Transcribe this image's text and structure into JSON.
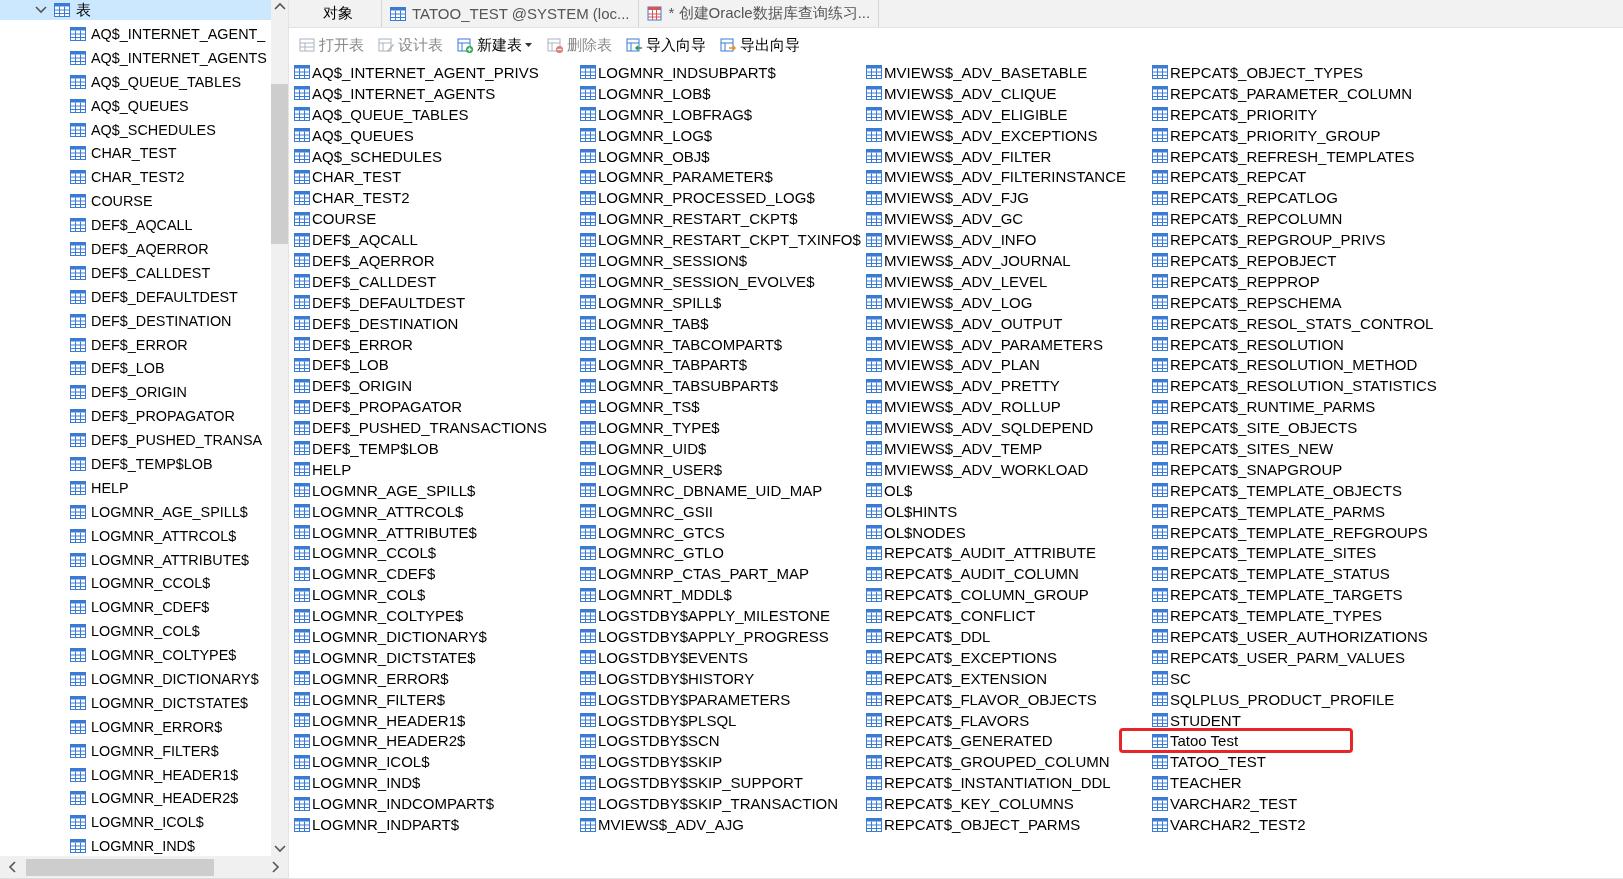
{
  "tree": {
    "label": "表",
    "expanded": true,
    "selected": true,
    "children": [
      "AQ$_INTERNET_AGENT_",
      "AQ$_INTERNET_AGENTS",
      "AQ$_QUEUE_TABLES",
      "AQ$_QUEUES",
      "AQ$_SCHEDULES",
      "CHAR_TEST",
      "CHAR_TEST2",
      "COURSE",
      "DEF$_AQCALL",
      "DEF$_AQERROR",
      "DEF$_CALLDEST",
      "DEF$_DEFAULTDEST",
      "DEF$_DESTINATION",
      "DEF$_ERROR",
      "DEF$_LOB",
      "DEF$_ORIGIN",
      "DEF$_PROPAGATOR",
      "DEF$_PUSHED_TRANSA",
      "DEF$_TEMP$LOB",
      "HELP",
      "LOGMNR_AGE_SPILL$",
      "LOGMNR_ATTRCOL$",
      "LOGMNR_ATTRIBUTE$",
      "LOGMNR_CCOL$",
      "LOGMNR_CDEF$",
      "LOGMNR_COL$",
      "LOGMNR_COLTYPE$",
      "LOGMNR_DICTIONARY$",
      "LOGMNR_DICTSTATE$",
      "LOGMNR_ERROR$",
      "LOGMNR_FILTER$",
      "LOGMNR_HEADER1$",
      "LOGMNR_HEADER2$",
      "LOGMNR_ICOL$",
      "LOGMNR_IND$"
    ]
  },
  "tabs": [
    {
      "label": "对象",
      "selected": true,
      "kind": "plain"
    },
    {
      "label": "TATOO_TEST @SYSTEM (loc...",
      "selected": false,
      "kind": "table"
    },
    {
      "label": "* 创建Oracle数据库查询练习...",
      "selected": false,
      "kind": "query"
    }
  ],
  "toolbar": [
    {
      "label": "打开表",
      "disabled": true,
      "kind": "open"
    },
    {
      "label": "设计表",
      "disabled": true,
      "kind": "design"
    },
    {
      "label": "新建表",
      "disabled": false,
      "kind": "new"
    },
    {
      "label": "删除表",
      "disabled": true,
      "kind": "delete"
    },
    {
      "label": "导入向导",
      "disabled": false,
      "kind": "import"
    },
    {
      "label": "导出向导",
      "disabled": false,
      "kind": "export"
    }
  ],
  "objects": [
    {
      "name": "AQ$_INTERNET_AGENT_PRIVS",
      "highlighted": false
    },
    {
      "name": "AQ$_INTERNET_AGENTS",
      "highlighted": false
    },
    {
      "name": "AQ$_QUEUE_TABLES",
      "highlighted": false
    },
    {
      "name": "AQ$_QUEUES",
      "highlighted": false
    },
    {
      "name": "AQ$_SCHEDULES",
      "highlighted": false
    },
    {
      "name": "CHAR_TEST",
      "highlighted": false
    },
    {
      "name": "CHAR_TEST2",
      "highlighted": false
    },
    {
      "name": "COURSE",
      "highlighted": false
    },
    {
      "name": "DEF$_AQCALL",
      "highlighted": false
    },
    {
      "name": "DEF$_AQERROR",
      "highlighted": false
    },
    {
      "name": "DEF$_CALLDEST",
      "highlighted": false
    },
    {
      "name": "DEF$_DEFAULTDEST",
      "highlighted": false
    },
    {
      "name": "DEF$_DESTINATION",
      "highlighted": false
    },
    {
      "name": "DEF$_ERROR",
      "highlighted": false
    },
    {
      "name": "DEF$_LOB",
      "highlighted": false
    },
    {
      "name": "DEF$_ORIGIN",
      "highlighted": false
    },
    {
      "name": "DEF$_PROPAGATOR",
      "highlighted": false
    },
    {
      "name": "DEF$_PUSHED_TRANSACTIONS",
      "highlighted": false
    },
    {
      "name": "DEF$_TEMP$LOB",
      "highlighted": false
    },
    {
      "name": "HELP",
      "highlighted": false
    },
    {
      "name": "LOGMNR_AGE_SPILL$",
      "highlighted": false
    },
    {
      "name": "LOGMNR_ATTRCOL$",
      "highlighted": false
    },
    {
      "name": "LOGMNR_ATTRIBUTE$",
      "highlighted": false
    },
    {
      "name": "LOGMNR_CCOL$",
      "highlighted": false
    },
    {
      "name": "LOGMNR_CDEF$",
      "highlighted": false
    },
    {
      "name": "LOGMNR_COL$",
      "highlighted": false
    },
    {
      "name": "LOGMNR_COLTYPE$",
      "highlighted": false
    },
    {
      "name": "LOGMNR_DICTIONARY$",
      "highlighted": false
    },
    {
      "name": "LOGMNR_DICTSTATE$",
      "highlighted": false
    },
    {
      "name": "LOGMNR_ERROR$",
      "highlighted": false
    },
    {
      "name": "LOGMNR_FILTER$",
      "highlighted": false
    },
    {
      "name": "LOGMNR_HEADER1$",
      "highlighted": false
    },
    {
      "name": "LOGMNR_HEADER2$",
      "highlighted": false
    },
    {
      "name": "LOGMNR_ICOL$",
      "highlighted": false
    },
    {
      "name": "LOGMNR_IND$",
      "highlighted": false
    },
    {
      "name": "LOGMNR_INDCOMPART$",
      "highlighted": false
    },
    {
      "name": "LOGMNR_INDPART$",
      "highlighted": false
    },
    {
      "name": "LOGMNR_INDSUBPART$",
      "highlighted": false
    },
    {
      "name": "LOGMNR_LOB$",
      "highlighted": false
    },
    {
      "name": "LOGMNR_LOBFRAG$",
      "highlighted": false
    },
    {
      "name": "LOGMNR_LOG$",
      "highlighted": false
    },
    {
      "name": "LOGMNR_OBJ$",
      "highlighted": false
    },
    {
      "name": "LOGMNR_PARAMETER$",
      "highlighted": false
    },
    {
      "name": "LOGMNR_PROCESSED_LOG$",
      "highlighted": false
    },
    {
      "name": "LOGMNR_RESTART_CKPT$",
      "highlighted": false
    },
    {
      "name": "LOGMNR_RESTART_CKPT_TXINFO$",
      "highlighted": false
    },
    {
      "name": "LOGMNR_SESSION$",
      "highlighted": false
    },
    {
      "name": "LOGMNR_SESSION_EVOLVE$",
      "highlighted": false
    },
    {
      "name": "LOGMNR_SPILL$",
      "highlighted": false
    },
    {
      "name": "LOGMNR_TAB$",
      "highlighted": false
    },
    {
      "name": "LOGMNR_TABCOMPART$",
      "highlighted": false
    },
    {
      "name": "LOGMNR_TABPART$",
      "highlighted": false
    },
    {
      "name": "LOGMNR_TABSUBPART$",
      "highlighted": false
    },
    {
      "name": "LOGMNR_TS$",
      "highlighted": false
    },
    {
      "name": "LOGMNR_TYPE$",
      "highlighted": false
    },
    {
      "name": "LOGMNR_UID$",
      "highlighted": false
    },
    {
      "name": "LOGMNR_USER$",
      "highlighted": false
    },
    {
      "name": "LOGMNRC_DBNAME_UID_MAP",
      "highlighted": false
    },
    {
      "name": "LOGMNRC_GSII",
      "highlighted": false
    },
    {
      "name": "LOGMNRC_GTCS",
      "highlighted": false
    },
    {
      "name": "LOGMNRC_GTLO",
      "highlighted": false
    },
    {
      "name": "LOGMNRP_CTAS_PART_MAP",
      "highlighted": false
    },
    {
      "name": "LOGMNRT_MDDL$",
      "highlighted": false
    },
    {
      "name": "LOGSTDBY$APPLY_MILESTONE",
      "highlighted": false
    },
    {
      "name": "LOGSTDBY$APPLY_PROGRESS",
      "highlighted": false
    },
    {
      "name": "LOGSTDBY$EVENTS",
      "highlighted": false
    },
    {
      "name": "LOGSTDBY$HISTORY",
      "highlighted": false
    },
    {
      "name": "LOGSTDBY$PARAMETERS",
      "highlighted": false
    },
    {
      "name": "LOGSTDBY$PLSQL",
      "highlighted": false
    },
    {
      "name": "LOGSTDBY$SCN",
      "highlighted": false
    },
    {
      "name": "LOGSTDBY$SKIP",
      "highlighted": false
    },
    {
      "name": "LOGSTDBY$SKIP_SUPPORT",
      "highlighted": false
    },
    {
      "name": "LOGSTDBY$SKIP_TRANSACTION",
      "highlighted": false
    },
    {
      "name": "MVIEWS$_ADV_AJG",
      "highlighted": false
    },
    {
      "name": "MVIEWS$_ADV_BASETABLE",
      "highlighted": false
    },
    {
      "name": "MVIEWS$_ADV_CLIQUE",
      "highlighted": false
    },
    {
      "name": "MVIEWS$_ADV_ELIGIBLE",
      "highlighted": false
    },
    {
      "name": "MVIEWS$_ADV_EXCEPTIONS",
      "highlighted": false
    },
    {
      "name": "MVIEWS$_ADV_FILTER",
      "highlighted": false
    },
    {
      "name": "MVIEWS$_ADV_FILTERINSTANCE",
      "highlighted": false
    },
    {
      "name": "MVIEWS$_ADV_FJG",
      "highlighted": false
    },
    {
      "name": "MVIEWS$_ADV_GC",
      "highlighted": false
    },
    {
      "name": "MVIEWS$_ADV_INFO",
      "highlighted": false
    },
    {
      "name": "MVIEWS$_ADV_JOURNAL",
      "highlighted": false
    },
    {
      "name": "MVIEWS$_ADV_LEVEL",
      "highlighted": false
    },
    {
      "name": "MVIEWS$_ADV_LOG",
      "highlighted": false
    },
    {
      "name": "MVIEWS$_ADV_OUTPUT",
      "highlighted": false
    },
    {
      "name": "MVIEWS$_ADV_PARAMETERS",
      "highlighted": false
    },
    {
      "name": "MVIEWS$_ADV_PLAN",
      "highlighted": false
    },
    {
      "name": "MVIEWS$_ADV_PRETTY",
      "highlighted": false
    },
    {
      "name": "MVIEWS$_ADV_ROLLUP",
      "highlighted": false
    },
    {
      "name": "MVIEWS$_ADV_SQLDEPEND",
      "highlighted": false
    },
    {
      "name": "MVIEWS$_ADV_TEMP",
      "highlighted": false
    },
    {
      "name": "MVIEWS$_ADV_WORKLOAD",
      "highlighted": false
    },
    {
      "name": "OL$",
      "highlighted": false
    },
    {
      "name": "OL$HINTS",
      "highlighted": false
    },
    {
      "name": "OL$NODES",
      "highlighted": false
    },
    {
      "name": "REPCAT$_AUDIT_ATTRIBUTE",
      "highlighted": false
    },
    {
      "name": "REPCAT$_AUDIT_COLUMN",
      "highlighted": false
    },
    {
      "name": "REPCAT$_COLUMN_GROUP",
      "highlighted": false
    },
    {
      "name": "REPCAT$_CONFLICT",
      "highlighted": false
    },
    {
      "name": "REPCAT$_DDL",
      "highlighted": false
    },
    {
      "name": "REPCAT$_EXCEPTIONS",
      "highlighted": false
    },
    {
      "name": "REPCAT$_EXTENSION",
      "highlighted": false
    },
    {
      "name": "REPCAT$_FLAVOR_OBJECTS",
      "highlighted": false
    },
    {
      "name": "REPCAT$_FLAVORS",
      "highlighted": false
    },
    {
      "name": "REPCAT$_GENERATED",
      "highlighted": false
    },
    {
      "name": "REPCAT$_GROUPED_COLUMN",
      "highlighted": false
    },
    {
      "name": "REPCAT$_INSTANTIATION_DDL",
      "highlighted": false
    },
    {
      "name": "REPCAT$_KEY_COLUMNS",
      "highlighted": false
    },
    {
      "name": "REPCAT$_OBJECT_PARMS",
      "highlighted": false
    },
    {
      "name": "REPCAT$_OBJECT_TYPES",
      "highlighted": false
    },
    {
      "name": "REPCAT$_PARAMETER_COLUMN",
      "highlighted": false
    },
    {
      "name": "REPCAT$_PRIORITY",
      "highlighted": false
    },
    {
      "name": "REPCAT$_PRIORITY_GROUP",
      "highlighted": false
    },
    {
      "name": "REPCAT$_REFRESH_TEMPLATES",
      "highlighted": false
    },
    {
      "name": "REPCAT$_REPCAT",
      "highlighted": false
    },
    {
      "name": "REPCAT$_REPCATLOG",
      "highlighted": false
    },
    {
      "name": "REPCAT$_REPCOLUMN",
      "highlighted": false
    },
    {
      "name": "REPCAT$_REPGROUP_PRIVS",
      "highlighted": false
    },
    {
      "name": "REPCAT$_REPOBJECT",
      "highlighted": false
    },
    {
      "name": "REPCAT$_REPPROP",
      "highlighted": false
    },
    {
      "name": "REPCAT$_REPSCHEMA",
      "highlighted": false
    },
    {
      "name": "REPCAT$_RESOL_STATS_CONTROL",
      "highlighted": false
    },
    {
      "name": "REPCAT$_RESOLUTION",
      "highlighted": false
    },
    {
      "name": "REPCAT$_RESOLUTION_METHOD",
      "highlighted": false
    },
    {
      "name": "REPCAT$_RESOLUTION_STATISTICS",
      "highlighted": false
    },
    {
      "name": "REPCAT$_RUNTIME_PARMS",
      "highlighted": false
    },
    {
      "name": "REPCAT$_SITE_OBJECTS",
      "highlighted": false
    },
    {
      "name": "REPCAT$_SITES_NEW",
      "highlighted": false
    },
    {
      "name": "REPCAT$_SNAPGROUP",
      "highlighted": false
    },
    {
      "name": "REPCAT$_TEMPLATE_OBJECTS",
      "highlighted": false
    },
    {
      "name": "REPCAT$_TEMPLATE_PARMS",
      "highlighted": false
    },
    {
      "name": "REPCAT$_TEMPLATE_REFGROUPS",
      "highlighted": false
    },
    {
      "name": "REPCAT$_TEMPLATE_SITES",
      "highlighted": false
    },
    {
      "name": "REPCAT$_TEMPLATE_STATUS",
      "highlighted": false
    },
    {
      "name": "REPCAT$_TEMPLATE_TARGETS",
      "highlighted": false
    },
    {
      "name": "REPCAT$_TEMPLATE_TYPES",
      "highlighted": false
    },
    {
      "name": "REPCAT$_USER_AUTHORIZATIONS",
      "highlighted": false
    },
    {
      "name": "REPCAT$_USER_PARM_VALUES",
      "highlighted": false
    },
    {
      "name": "SC",
      "highlighted": false
    },
    {
      "name": "SQLPLUS_PRODUCT_PROFILE",
      "highlighted": false
    },
    {
      "name": "STUDENT",
      "highlighted": false
    },
    {
      "name": "Tatoo Test",
      "highlighted": true
    },
    {
      "name": "TATOO_TEST",
      "highlighted": false
    },
    {
      "name": "TEACHER",
      "highlighted": false
    },
    {
      "name": "VARCHAR2_TEST",
      "highlighted": false
    },
    {
      "name": "VARCHAR2_TEST2",
      "highlighted": false
    }
  ]
}
